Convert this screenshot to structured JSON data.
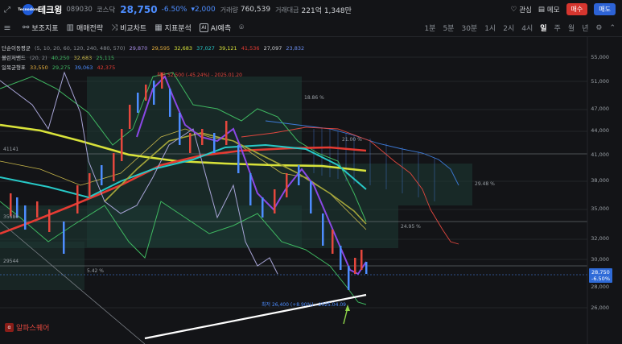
{
  "header": {
    "expand_icon": "expand-icon",
    "logo_text": "Tecnodom",
    "name": "테크윙",
    "code": "089030",
    "market": "코스닥",
    "price": "28,750",
    "change_pct": "-6.50%",
    "change_amt": "▾2,000",
    "volume_label": "거래량",
    "volume": "760,539",
    "amount_label": "거래대금",
    "amount": "221억 1,348만",
    "favorite_label": "관심",
    "memo_label": "메모",
    "buy_label": "매수",
    "sell_label": "매도",
    "colors": {
      "down": "#4d8dff",
      "buy": "#d6362f",
      "sell": "#2d63d6"
    }
  },
  "toolbar": {
    "items": [
      "보조지표",
      "매매전략",
      "비교차트",
      "지표분석",
      "AI예측"
    ],
    "ai_badge": "AI",
    "periods": [
      "1분",
      "5분",
      "30분",
      "1시",
      "2시",
      "4시",
      "일",
      "주",
      "월",
      "년"
    ],
    "active_period": "일"
  },
  "legends": {
    "sma": {
      "label": "단순이동평균",
      "params": "(5, 10, 20, 60, 120, 240, 480, 570)",
      "values": [
        "29,870",
        "29,595",
        "32,683",
        "37,027",
        "39,121",
        "41,536",
        "27,097",
        "23,832"
      ]
    },
    "bollinger": {
      "label": "볼린저밴드",
      "params": "(20, 2)",
      "values": [
        "40,250",
        "32,683",
        "25,115"
      ]
    },
    "ichimoku": {
      "label": "일목균형표",
      "values": [
        "33,550",
        "29,275",
        "39,063",
        "42,375"
      ]
    }
  },
  "y_axis": [
    "55,000",
    "51,000",
    "47,000",
    "44,000",
    "41,000",
    "38,000",
    "35,000",
    "32,000",
    "30,000",
    "28,000",
    "26,000"
  ],
  "current_price_tag": [
    "28,750",
    "-6.50%"
  ],
  "annotations": {
    "high": "최고 52,500 (-45.24%) - 2025.01.20",
    "low": "최저 26,400 (+8.90%) - 2025.04.09",
    "pct_1886": "18.86 %",
    "pct_2100": "21.00 %",
    "pct_2948": "29.48 %",
    "pct_2495": "24.95 %",
    "pct_542": "5.42 %",
    "lvl_41141": "41141",
    "lvl_35686": "35686",
    "lvl_29544": "29544"
  },
  "watermark": "알파스퀘어",
  "watermark_icon": "α"
}
